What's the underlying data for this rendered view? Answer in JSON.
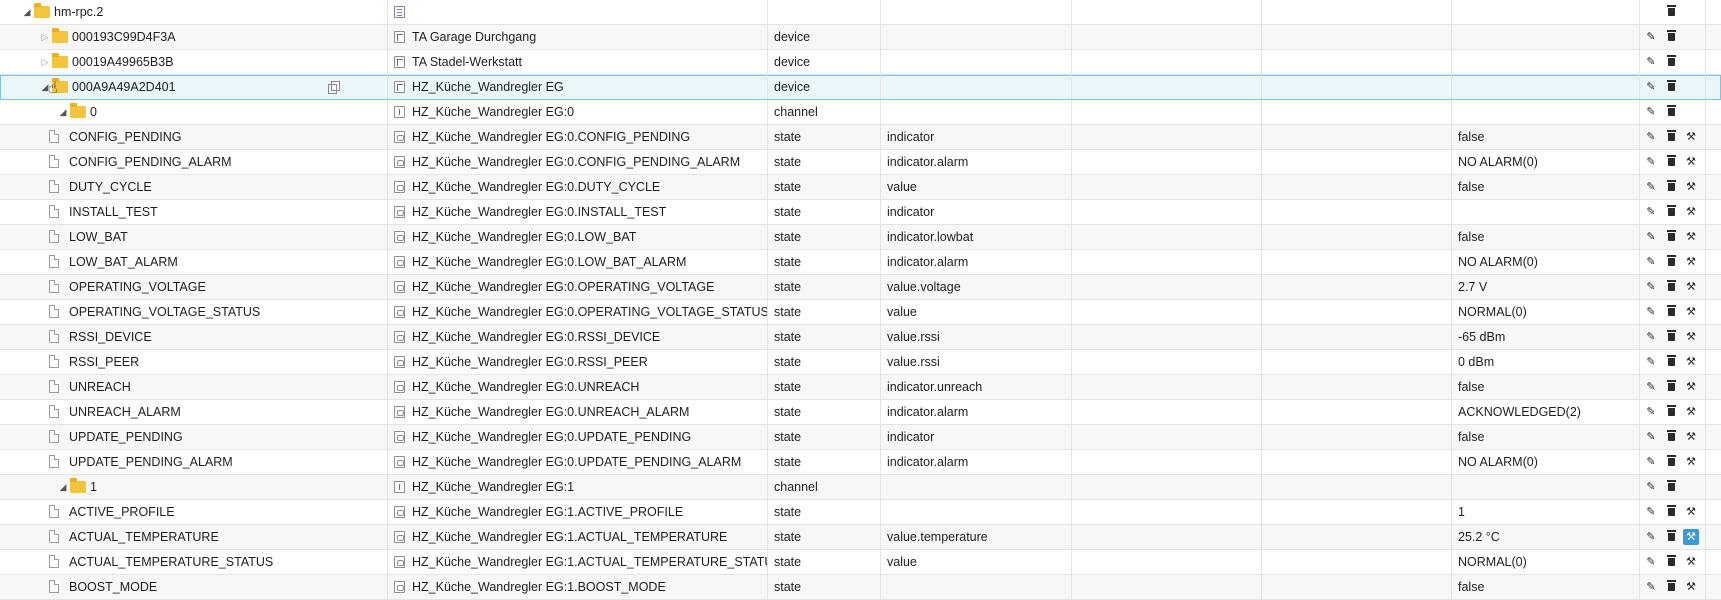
{
  "rows": [
    {
      "id": "hm-rpc.2",
      "name": "",
      "type": "",
      "role": "",
      "value": "",
      "level": 0,
      "icon": "folder",
      "toggle": "open",
      "ntype": "adapter",
      "buttons": [
        "delete"
      ]
    },
    {
      "id": "000193C99D4F3A",
      "name": "TA Garage Durchgang",
      "type": "device",
      "role": "",
      "value": "",
      "level": 1,
      "icon": "folder",
      "toggle": "closed",
      "ntype": "device",
      "buttons": [
        "edit",
        "delete"
      ]
    },
    {
      "id": "00019A49965B3B",
      "name": "TA Stadel-Werkstatt",
      "type": "device",
      "role": "",
      "value": "",
      "level": 1,
      "icon": "folder",
      "toggle": "closed",
      "ntype": "device",
      "buttons": [
        "edit",
        "delete"
      ]
    },
    {
      "id": "000A9A49A2D401",
      "name": "HZ_Küche_Wandregler EG",
      "type": "device",
      "role": "",
      "value": "",
      "level": 1,
      "icon": "folder",
      "toggle": "open",
      "ntype": "device",
      "buttons": [
        "edit",
        "delete"
      ],
      "selected": true
    },
    {
      "id": "0",
      "name": "HZ_Küche_Wandregler EG:0",
      "type": "channel",
      "role": "",
      "value": "",
      "level": 2,
      "icon": "folder",
      "toggle": "open",
      "ntype": "channel",
      "buttons": [
        "edit",
        "delete"
      ]
    },
    {
      "id": "CONFIG_PENDING",
      "name": "HZ_Küche_Wandregler EG:0.CONFIG_PENDING",
      "type": "state",
      "role": "indicator",
      "value": "false",
      "level": 3,
      "icon": "file",
      "ntype": "state",
      "buttons": [
        "edit",
        "delete",
        "config"
      ]
    },
    {
      "id": "CONFIG_PENDING_ALARM",
      "name": "HZ_Küche_Wandregler EG:0.CONFIG_PENDING_ALARM",
      "type": "state",
      "role": "indicator.alarm",
      "value": "NO ALARM(0)",
      "level": 3,
      "icon": "file",
      "ntype": "state",
      "buttons": [
        "edit",
        "delete",
        "config"
      ]
    },
    {
      "id": "DUTY_CYCLE",
      "name": "HZ_Küche_Wandregler EG:0.DUTY_CYCLE",
      "type": "state",
      "role": "value",
      "value": "false",
      "level": 3,
      "icon": "file",
      "ntype": "state",
      "buttons": [
        "edit",
        "delete",
        "config"
      ]
    },
    {
      "id": "INSTALL_TEST",
      "name": "HZ_Küche_Wandregler EG:0.INSTALL_TEST",
      "type": "state",
      "role": "indicator",
      "value": "",
      "level": 3,
      "icon": "file",
      "ntype": "state",
      "buttons": [
        "edit",
        "delete",
        "config"
      ]
    },
    {
      "id": "LOW_BAT",
      "name": "HZ_Küche_Wandregler EG:0.LOW_BAT",
      "type": "state",
      "role": "indicator.lowbat",
      "value": "false",
      "level": 3,
      "icon": "file",
      "ntype": "state",
      "buttons": [
        "edit",
        "delete",
        "config"
      ]
    },
    {
      "id": "LOW_BAT_ALARM",
      "name": "HZ_Küche_Wandregler EG:0.LOW_BAT_ALARM",
      "type": "state",
      "role": "indicator.alarm",
      "value": "NO ALARM(0)",
      "level": 3,
      "icon": "file",
      "ntype": "state",
      "buttons": [
        "edit",
        "delete",
        "config"
      ]
    },
    {
      "id": "OPERATING_VOLTAGE",
      "name": "HZ_Küche_Wandregler EG:0.OPERATING_VOLTAGE",
      "type": "state",
      "role": "value.voltage",
      "value": "2.7 V",
      "level": 3,
      "icon": "file",
      "ntype": "state",
      "buttons": [
        "edit",
        "delete",
        "config"
      ]
    },
    {
      "id": "OPERATING_VOLTAGE_STATUS",
      "name": "HZ_Küche_Wandregler EG:0.OPERATING_VOLTAGE_STATUS",
      "type": "state",
      "role": "value",
      "value": "NORMAL(0)",
      "level": 3,
      "icon": "file",
      "ntype": "state",
      "buttons": [
        "edit",
        "delete",
        "config"
      ]
    },
    {
      "id": "RSSI_DEVICE",
      "name": "HZ_Küche_Wandregler EG:0.RSSI_DEVICE",
      "type": "state",
      "role": "value.rssi",
      "value": "-65 dBm",
      "level": 3,
      "icon": "file",
      "ntype": "state",
      "buttons": [
        "edit",
        "delete",
        "config"
      ]
    },
    {
      "id": "RSSI_PEER",
      "name": "HZ_Küche_Wandregler EG:0.RSSI_PEER",
      "type": "state",
      "role": "value.rssi",
      "value": "0 dBm",
      "level": 3,
      "icon": "file",
      "ntype": "state",
      "buttons": [
        "edit",
        "delete",
        "config"
      ]
    },
    {
      "id": "UNREACH",
      "name": "HZ_Küche_Wandregler EG:0.UNREACH",
      "type": "state",
      "role": "indicator.unreach",
      "value": "false",
      "level": 3,
      "icon": "file",
      "ntype": "state",
      "buttons": [
        "edit",
        "delete",
        "config"
      ]
    },
    {
      "id": "UNREACH_ALARM",
      "name": "HZ_Küche_Wandregler EG:0.UNREACH_ALARM",
      "type": "state",
      "role": "indicator.alarm",
      "value": "ACKNOWLEDGED(2)",
      "level": 3,
      "icon": "file",
      "ntype": "state",
      "buttons": [
        "edit",
        "delete",
        "config"
      ]
    },
    {
      "id": "UPDATE_PENDING",
      "name": "HZ_Küche_Wandregler EG:0.UPDATE_PENDING",
      "type": "state",
      "role": "indicator",
      "value": "false",
      "level": 3,
      "icon": "file",
      "ntype": "state",
      "buttons": [
        "edit",
        "delete",
        "config"
      ]
    },
    {
      "id": "UPDATE_PENDING_ALARM",
      "name": "HZ_Küche_Wandregler EG:0.UPDATE_PENDING_ALARM",
      "type": "state",
      "role": "indicator.alarm",
      "value": "NO ALARM(0)",
      "level": 3,
      "icon": "file",
      "ntype": "state",
      "buttons": [
        "edit",
        "delete",
        "config"
      ]
    },
    {
      "id": "1",
      "name": "HZ_Küche_Wandregler EG:1",
      "type": "channel",
      "role": "",
      "value": "",
      "level": 2,
      "icon": "folder",
      "toggle": "open",
      "ntype": "channel",
      "buttons": [
        "edit",
        "delete"
      ]
    },
    {
      "id": "ACTIVE_PROFILE",
      "name": "HZ_Küche_Wandregler EG:1.ACTIVE_PROFILE",
      "type": "state",
      "role": "",
      "value": "1",
      "level": 3,
      "icon": "file",
      "ntype": "state",
      "buttons": [
        "edit",
        "delete",
        "config"
      ]
    },
    {
      "id": "ACTUAL_TEMPERATURE",
      "name": "HZ_Küche_Wandregler EG:1.ACTUAL_TEMPERATURE",
      "type": "state",
      "role": "value.temperature",
      "value": "25.2 °C",
      "level": 3,
      "icon": "file",
      "ntype": "state",
      "buttons": [
        "edit",
        "delete",
        "config"
      ],
      "config_active": true
    },
    {
      "id": "ACTUAL_TEMPERATURE_STATUS",
      "name": "HZ_Küche_Wandregler EG:1.ACTUAL_TEMPERATURE_STATUS",
      "type": "state",
      "role": "value",
      "value": "NORMAL(0)",
      "level": 3,
      "icon": "file",
      "ntype": "state",
      "buttons": [
        "edit",
        "delete",
        "config"
      ]
    },
    {
      "id": "BOOST_MODE",
      "name": "HZ_Küche_Wandregler EG:1.BOOST_MODE",
      "type": "state",
      "role": "",
      "value": "false",
      "level": 3,
      "icon": "file",
      "ntype": "state",
      "buttons": [
        "edit",
        "delete",
        "config"
      ]
    }
  ],
  "icons": {
    "edit": "pencil-icon",
    "delete": "trash-icon",
    "config": "wrench-icon",
    "copy": "copy-icon"
  },
  "colors": {
    "selected_bg": "#ebf6fb",
    "selected_border": "#7fc3e0",
    "config_active": "#3b99d6",
    "folder": "#f2c53d"
  }
}
